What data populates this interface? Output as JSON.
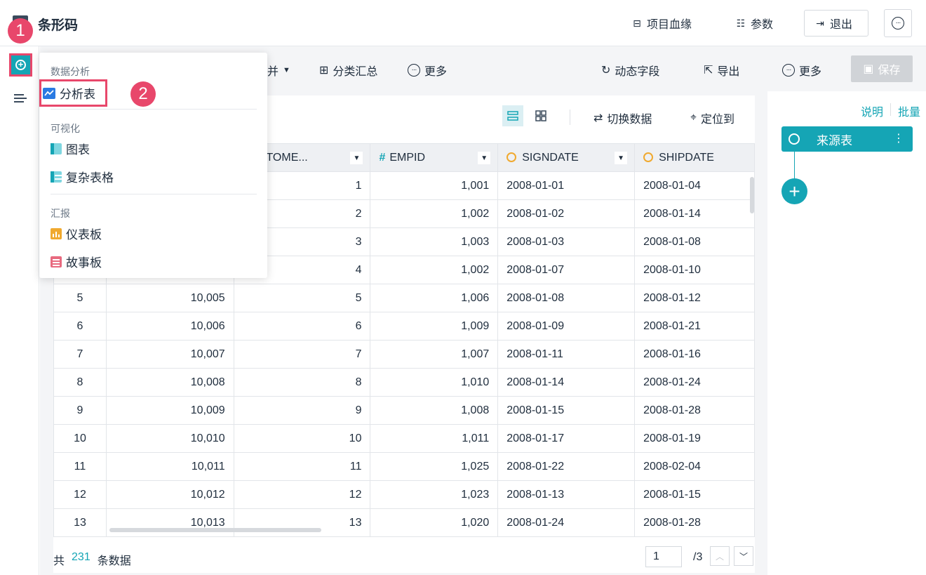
{
  "header": {
    "title": "条形码",
    "lineage": "项目血缘",
    "params": "参数",
    "exit": "退出"
  },
  "badges": {
    "one": "1",
    "two": "2"
  },
  "toolbar": {
    "merge": "并",
    "group_summary": "分类汇总",
    "more_left": "更多",
    "dynamic_field": "动态字段",
    "export": "导出",
    "more_right": "更多",
    "save": "保存"
  },
  "table_toolbar": {
    "switch_data": "切换数据",
    "locate": "定位到"
  },
  "dropdown": {
    "sec_analysis": "数据分析",
    "analysis_table": "分析表",
    "sec_visual": "可视化",
    "chart": "图表",
    "complex_table": "复杂表格",
    "sec_report": "汇报",
    "dashboard": "仪表板",
    "storyboard": "故事板"
  },
  "columns": {
    "customer": "CUSTOME...",
    "empid": "EMPID",
    "signdate": "SIGNDATE",
    "shipdate": "SHIPDATE"
  },
  "rows": [
    {
      "c1": "",
      "c2": "",
      "c3": "1",
      "c4": "1,001",
      "c5": "2008-01-01",
      "c6": "2008-01-04"
    },
    {
      "c1": "",
      "c2": "",
      "c3": "2",
      "c4": "1,002",
      "c5": "2008-01-02",
      "c6": "2008-01-14"
    },
    {
      "c1": "",
      "c2": "",
      "c3": "3",
      "c4": "1,003",
      "c5": "2008-01-03",
      "c6": "2008-01-08"
    },
    {
      "c1": "",
      "c2": "",
      "c3": "4",
      "c4": "1,002",
      "c5": "2008-01-07",
      "c6": "2008-01-10"
    },
    {
      "c1": "5",
      "c2": "10,005",
      "c3": "5",
      "c4": "1,006",
      "c5": "2008-01-08",
      "c6": "2008-01-12"
    },
    {
      "c1": "6",
      "c2": "10,006",
      "c3": "6",
      "c4": "1,009",
      "c5": "2008-01-09",
      "c6": "2008-01-21"
    },
    {
      "c1": "7",
      "c2": "10,007",
      "c3": "7",
      "c4": "1,007",
      "c5": "2008-01-11",
      "c6": "2008-01-16"
    },
    {
      "c1": "8",
      "c2": "10,008",
      "c3": "8",
      "c4": "1,010",
      "c5": "2008-01-14",
      "c6": "2008-01-24"
    },
    {
      "c1": "9",
      "c2": "10,009",
      "c3": "9",
      "c4": "1,008",
      "c5": "2008-01-15",
      "c6": "2008-01-28"
    },
    {
      "c1": "10",
      "c2": "10,010",
      "c3": "10",
      "c4": "1,011",
      "c5": "2008-01-17",
      "c6": "2008-01-19"
    },
    {
      "c1": "11",
      "c2": "10,011",
      "c3": "11",
      "c4": "1,025",
      "c5": "2008-01-22",
      "c6": "2008-02-04"
    },
    {
      "c1": "12",
      "c2": "10,012",
      "c3": "12",
      "c4": "1,023",
      "c5": "2008-01-13",
      "c6": "2008-01-15"
    },
    {
      "c1": "13",
      "c2": "10,013",
      "c3": "13",
      "c4": "1,020",
      "c5": "2008-01-24",
      "c6": "2008-01-28"
    }
  ],
  "footer": {
    "prefix": "共",
    "count": "231",
    "suffix": "条数据",
    "page": "1",
    "total_pages": "/3"
  },
  "right_panel": {
    "explain": "说明",
    "batch": "批量",
    "source_node": "来源表"
  },
  "colors": {
    "accent": "#15a5b5",
    "highlight": "#e8476b"
  }
}
